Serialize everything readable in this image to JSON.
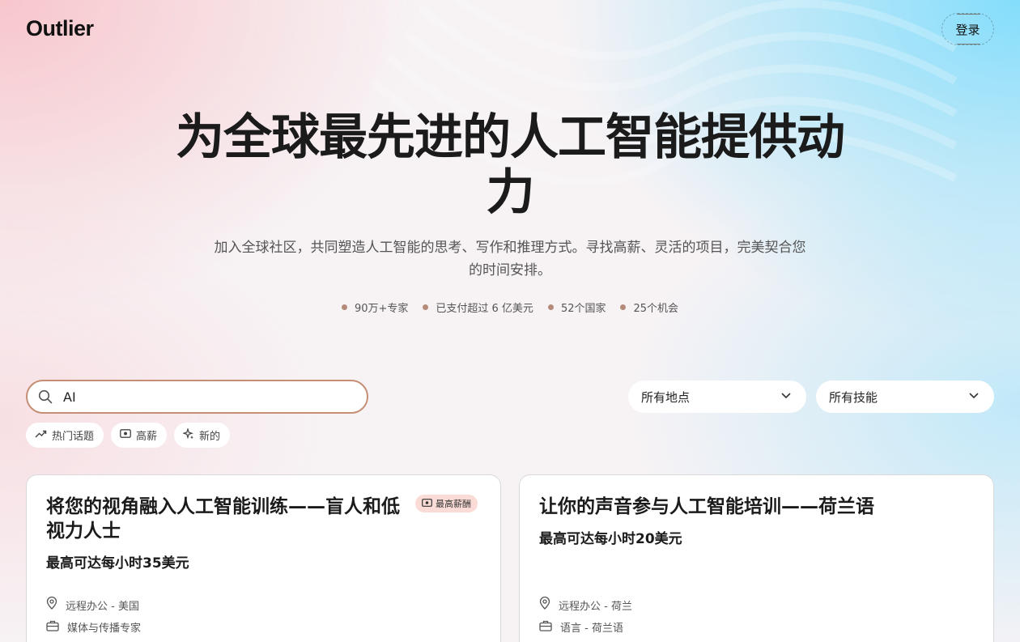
{
  "header": {
    "logo": "Outlier",
    "login_label": "登录"
  },
  "hero": {
    "title": "为全球最先进的人工智能提供动力",
    "subtitle": "加入全球社区，共同塑造人工智能的思考、写作和推理方式。寻找高薪、灵活的项目，完美契合您的时间安排。",
    "stats": [
      "90万+专家",
      "已支付超过 6 亿美元",
      "52个国家",
      "25个机会"
    ]
  },
  "search": {
    "value": "AI",
    "placeholder": ""
  },
  "filters": {
    "location": "所有地点",
    "skills": "所有技能"
  },
  "chips": [
    {
      "label": "热门话题",
      "icon": "trending-icon"
    },
    {
      "label": "高薪",
      "icon": "money-icon"
    },
    {
      "label": "新的",
      "icon": "sparkle-icon"
    }
  ],
  "cards": [
    {
      "title": "将您的视角融入人工智能训练——盲人和低视力人士",
      "pay": "最高可达每小时35美元",
      "badge": "最高薪酬",
      "location": "远程办公 - 美国",
      "category": "媒体与传播专家"
    },
    {
      "title": "让你的声音参与人工智能培训——荷兰语",
      "pay": "最高可达每小时20美元",
      "badge": "",
      "location": "远程办公 - 荷兰",
      "category": "语言 - 荷兰语"
    }
  ],
  "colors": {
    "accent": "#c48f75",
    "badge_bg": "#fadbd6",
    "dot": "#b58a78"
  }
}
